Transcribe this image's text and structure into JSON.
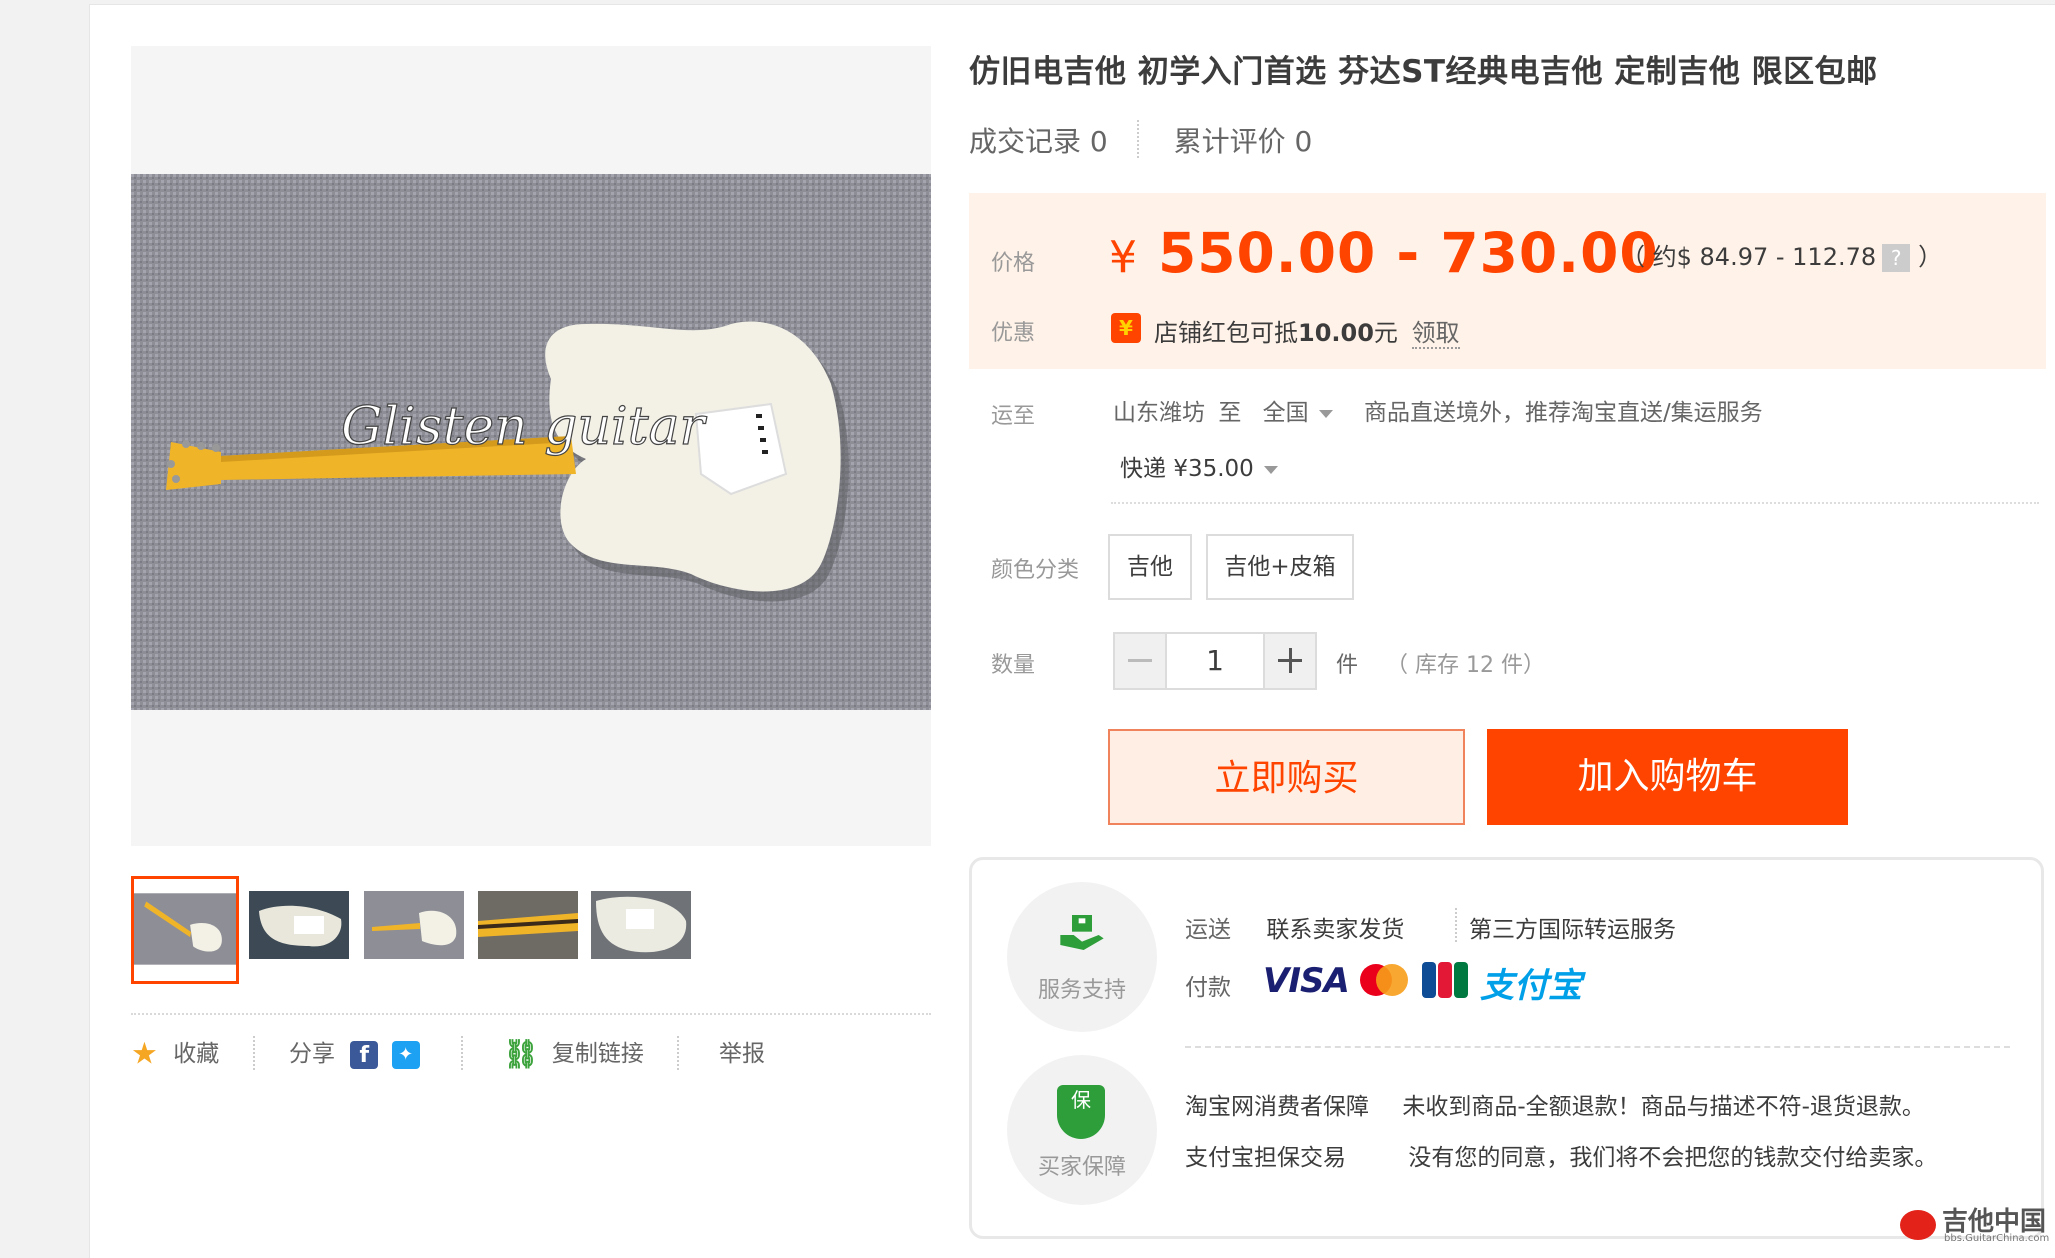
{
  "product": {
    "title": "仿旧电吉他 初学入门首选 芬达ST经典电吉他 定制吉他 限区包邮",
    "sales_label": "成交记录",
    "sales_count": "0",
    "reviews_label": "累计评价",
    "reviews_count": "0",
    "watermark_text": "Glisten guitar"
  },
  "price": {
    "label": "价格",
    "currency_symbol": "¥",
    "range": "550.00 - 730.00",
    "converted_open": "（ 约$ 84.97 - 112.78",
    "converted_close": "）",
    "help_icon_text": "?",
    "promo_label": "优惠",
    "coupon_icon_text": "¥",
    "coupon_text": "店铺红包可抵",
    "coupon_amount": "10.00",
    "coupon_unit": "元",
    "coupon_link": "领取"
  },
  "shipping": {
    "label": "运至",
    "origin": "山东潍坊",
    "to": "至",
    "destination": "全国",
    "note": "商品直送境外，推荐淘宝直送/集运服务",
    "method": "快递",
    "fee": "¥35.00"
  },
  "sku": {
    "label": "颜色分类",
    "options": [
      "吉他",
      "吉他+皮箱"
    ]
  },
  "quantity": {
    "label": "数量",
    "value": "1",
    "unit": "件",
    "stock": "（ 库存 12 件）"
  },
  "buttons": {
    "buy_now": "立即购买",
    "add_to_cart": "加入购物车"
  },
  "actions": {
    "favorite": "收藏",
    "share": "分享",
    "copy_link": "复制链接",
    "report": "举报"
  },
  "service": {
    "support_label": "服务支持",
    "shipping_key": "运送",
    "shipping_value1": "联系卖家发货",
    "shipping_value2": "第三方国际转运服务",
    "payment_key": "付款",
    "payment_methods": [
      "VISA",
      "MasterCard",
      "JCB",
      "支付宝"
    ],
    "protect_label": "买家保障",
    "protect_icon_text": "保",
    "guarantee1_key": "淘宝网消费者保障",
    "guarantee1_value": "未收到商品-全额退款！商品与描述不符-退货退款。",
    "guarantee2_key": "支付宝担保交易",
    "guarantee2_value": "没有您的同意，我们将不会把您的钱款交付给卖家。"
  },
  "site_watermark": {
    "title": "吉他中国",
    "url": "bbs.GuitarChina.com"
  },
  "colors": {
    "accent": "#ff4400",
    "price_bg": "#fff2e8",
    "guitar_neck": "#f0b429"
  }
}
